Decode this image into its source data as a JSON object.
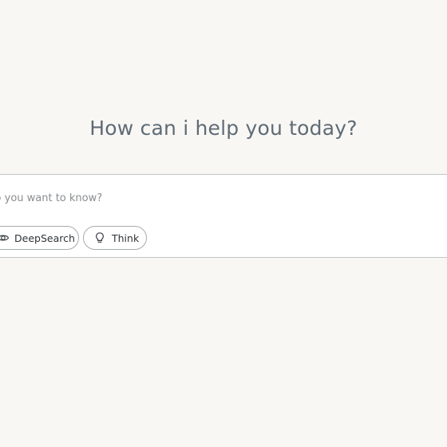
{
  "main": {
    "headline": "How can i help you today?"
  },
  "composer": {
    "placeholder": "What do you want to know?",
    "buttons": [
      {
        "label": "DeepSearch",
        "icon": "deepsearch-icon"
      },
      {
        "label": "Think",
        "icon": "lightbulb-icon"
      }
    ]
  },
  "colors": {
    "background": "#f8f7f4",
    "headline": "#5f6b76",
    "border": "#c3c6c9"
  }
}
